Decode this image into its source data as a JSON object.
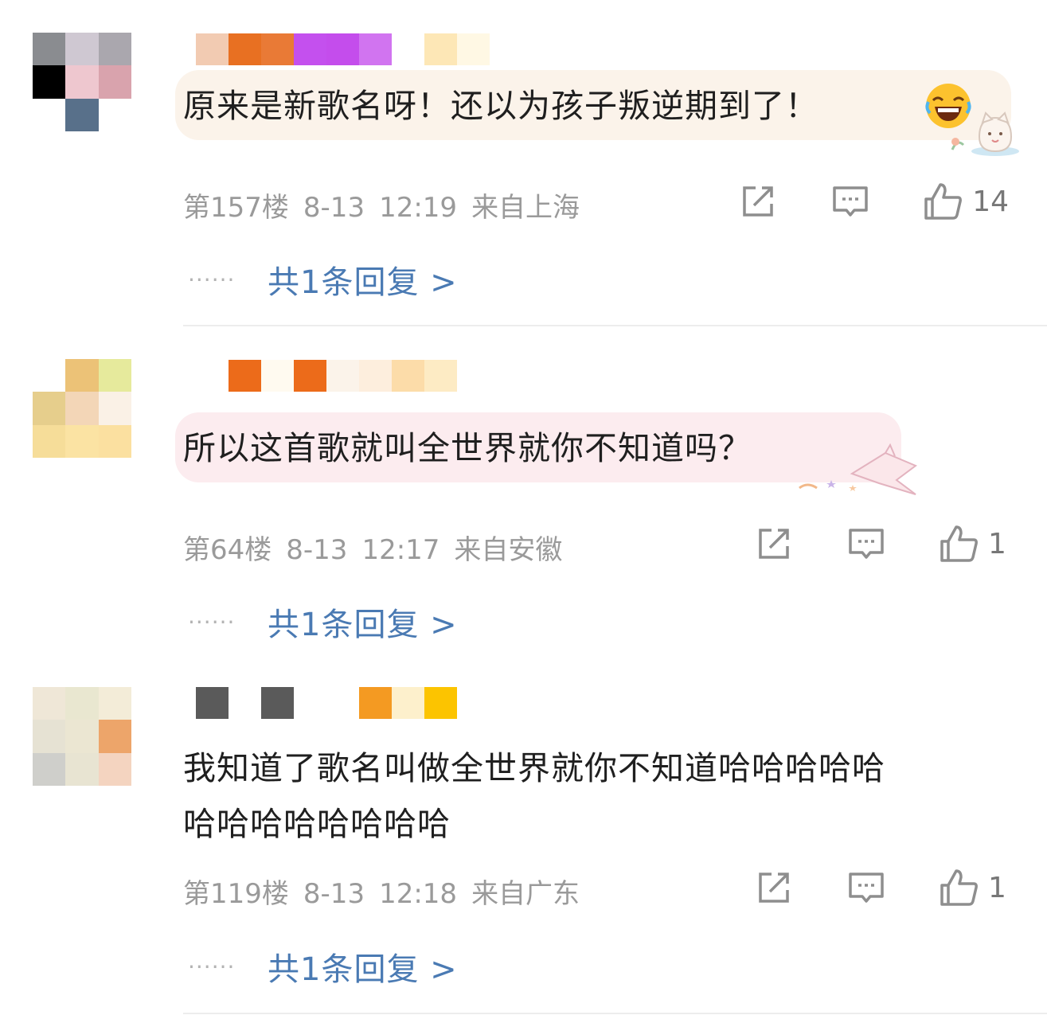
{
  "comments": [
    {
      "text_lines": [
        "原来是新歌名呀！还以为孩子叛逆期到了！"
      ],
      "floor": "第157楼",
      "date": "8-13",
      "time": "12:19",
      "location": "来自上海",
      "likes": "14",
      "replies": "共1条回复 >",
      "bubble_color": "#fbf3ea",
      "avatar_colors": [
        "#8a8c90",
        "#cfc8d2",
        "#aaa7ae",
        "#000000",
        "#eec7cf",
        "#d9a3ad",
        "#ffffff",
        "#58708a",
        "#ffffff"
      ],
      "name_colors": [
        "#f2cbb2",
        "#e87022",
        "#e97a36",
        "#c450ee",
        "#c44dec",
        "#d174f0",
        "#ffffff",
        "#fde7b6",
        "#fff8e4"
      ]
    },
    {
      "text_lines": [
        "所以这首歌就叫全世界就你不知道吗？"
      ],
      "floor": "第64楼",
      "date": "8-13",
      "time": "12:17",
      "location": "来自安徽",
      "likes": "1",
      "replies": "共1条回复 >",
      "bubble_color": "#fcecef",
      "avatar_colors": [
        "#ffffff",
        "#ecc277",
        "#e6ea9c",
        "#e6ce8c",
        "#f3d6b7",
        "#faf1e6",
        "#f6dd99",
        "#fbe3a3",
        "#fbe0a0"
      ],
      "name_colors": [
        "#ffffff",
        "#ec6b1a",
        "#fffaf0",
        "#ec6b1a",
        "#fbf3ea",
        "#fdeedd",
        "#fcdca9",
        "#fdebc4"
      ]
    },
    {
      "text_lines": [
        "我知道了歌名叫做全世界就你不知道哈哈哈哈哈",
        "哈哈哈哈哈哈哈哈"
      ],
      "floor": "第119楼",
      "date": "8-13",
      "time": "12:18",
      "location": "来自广东",
      "likes": "1",
      "replies": "共1条回复 >",
      "bubble_color": "#ffffff",
      "avatar_colors": [
        "#efe7d7",
        "#e9e7d0",
        "#f3ecd8",
        "#e6e2d3",
        "#ebe6d2",
        "#eda56a",
        "#cfcfcb",
        "#e8e4d2",
        "#f4d4c0"
      ],
      "name_colors": [
        "#5a5a5a",
        "#ffffff",
        "#5a5a5a",
        "#ffffff",
        "#ffffff",
        "#f49a22",
        "#fdf0cc",
        "#fcc400"
      ]
    }
  ]
}
